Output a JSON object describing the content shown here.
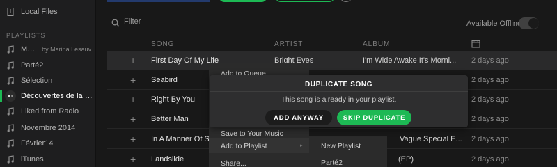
{
  "sidebar": {
    "local_files": "Local Files",
    "playlists_heading": "PLAYLISTS",
    "items": [
      {
        "label": "Mood",
        "sub": "by Marina Lesauv..."
      },
      {
        "label": "Parté2",
        "sub": ""
      },
      {
        "label": "Sélection",
        "sub": ""
      },
      {
        "label": "Découvertes de la se...",
        "sub": ""
      },
      {
        "label": "Liked from Radio",
        "sub": ""
      },
      {
        "label": "Novembre 2014",
        "sub": ""
      },
      {
        "label": "Février14",
        "sub": ""
      },
      {
        "label": "iTunes",
        "sub": ""
      }
    ],
    "active_index": 3
  },
  "filter": {
    "placeholder": "Filter"
  },
  "available_offline": {
    "label": "Available Offline",
    "enabled": false
  },
  "table": {
    "headers": {
      "song": "SONG",
      "artist": "ARTIST",
      "album": "ALBUM",
      "added_icon": "calendar-icon"
    },
    "rows": [
      {
        "song": "First Day Of My Life",
        "artist": "Bright Eyes",
        "album": "I'm Wide Awake It's Morni...",
        "added": "2 days ago"
      },
      {
        "song": "Seabird",
        "artist": "",
        "album": "",
        "added": "2 days ago"
      },
      {
        "song": "Right By You",
        "artist": "",
        "album": "",
        "added": "2 days ago"
      },
      {
        "song": "Better Man",
        "artist": "",
        "album": "",
        "added": "2 days ago"
      },
      {
        "song": "In A Manner Of Spe",
        "artist": "",
        "album": "Vague Special E...",
        "added": "2 days ago"
      },
      {
        "song": "Landslide",
        "artist": "",
        "album": "(EP)",
        "added": "2 days ago"
      }
    ],
    "highlight_index": 0
  },
  "context_menu": {
    "items": [
      "Add to Queue",
      "Save to Your Music",
      "Add to Playlist",
      "Share..."
    ],
    "submenu": [
      "New Playlist",
      "Parté2"
    ]
  },
  "dialog": {
    "title": "DUPLICATE SONG",
    "message": "This song is already in your playlist.",
    "add_anyway": "ADD ANYWAY",
    "skip": "SKIP DUPLICATE"
  },
  "colors": {
    "accent": "#1db954",
    "background": "#181818",
    "sidebar": "#1e1e1f"
  }
}
